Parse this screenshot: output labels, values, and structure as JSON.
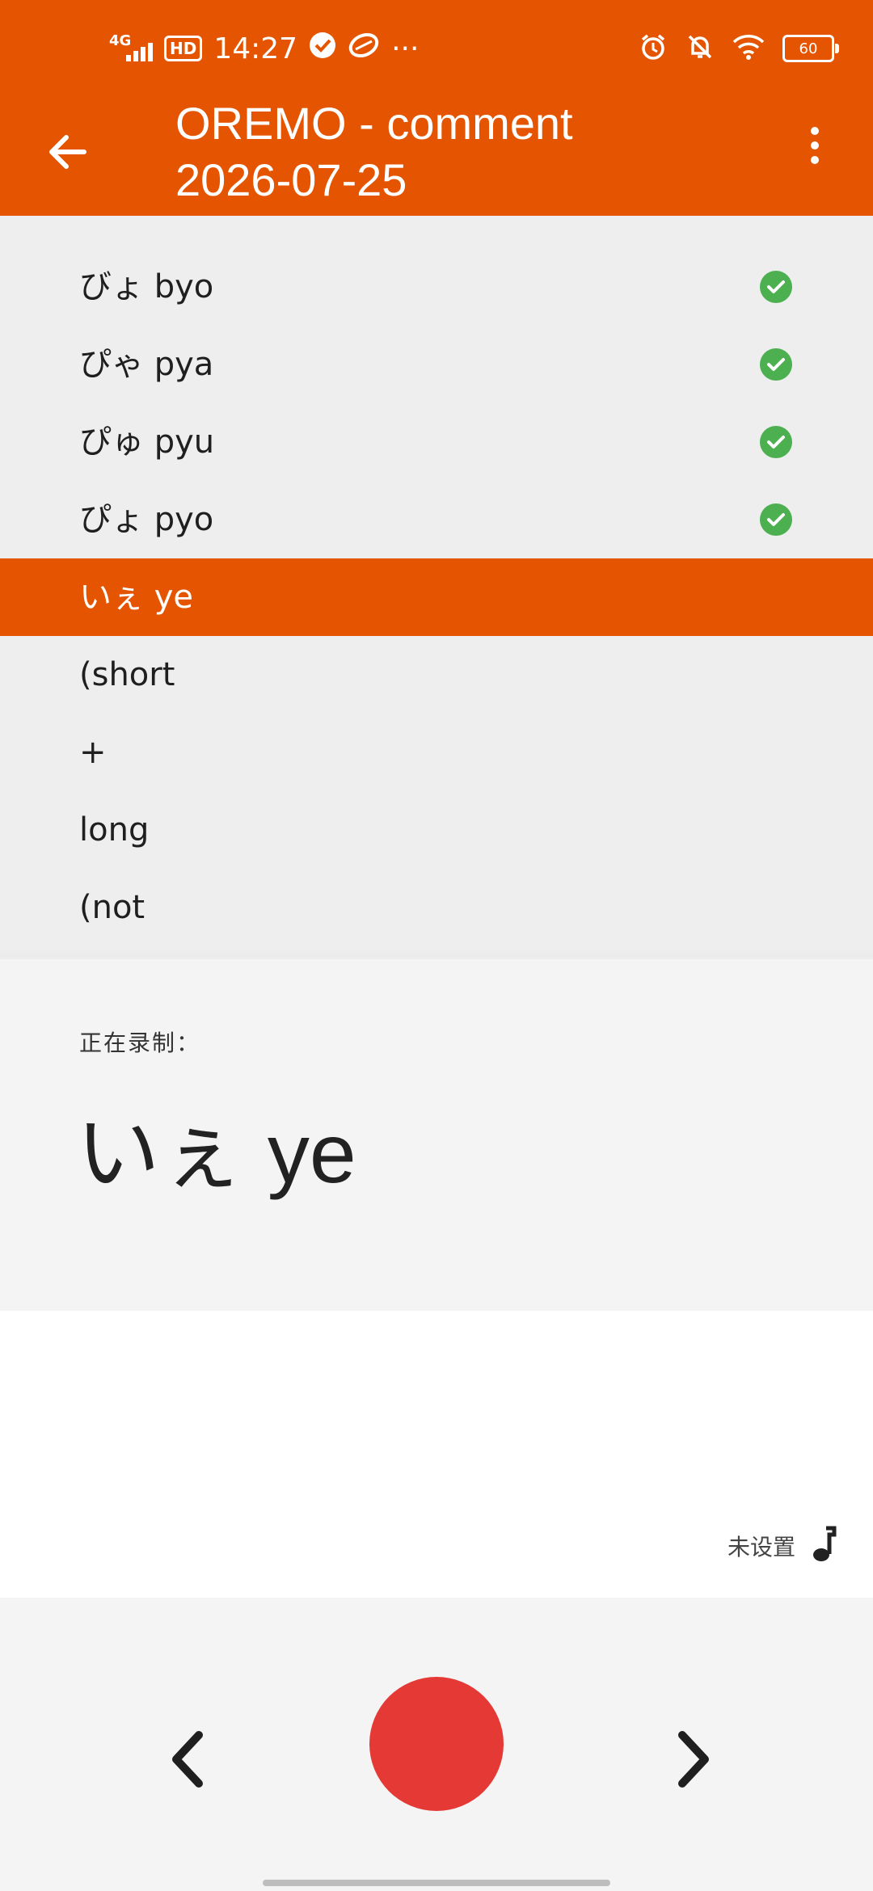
{
  "status_bar": {
    "network": "4G",
    "hd": "HD",
    "time": "14:27",
    "more": "···",
    "battery": "60"
  },
  "header": {
    "title": "OREMO - comment 2026-07-25",
    "accent": "#e55400"
  },
  "list": {
    "items": [
      {
        "label": "びょ byo",
        "done": true
      },
      {
        "label": "ぴゃ pya",
        "done": true
      },
      {
        "label": "ぴゅ pyu",
        "done": true
      },
      {
        "label": "ぴょ pyo",
        "done": true
      },
      {
        "label": "いぇ ye",
        "selected": true
      },
      {
        "label": "(short"
      },
      {
        "label": "+"
      },
      {
        "label": "long"
      },
      {
        "label": "(not"
      }
    ]
  },
  "recording": {
    "caption": "正在录制：",
    "current": "いぇ ye"
  },
  "tone": {
    "label": "未设置",
    "icon": "music-note-icon"
  },
  "controls": {
    "prev_icon": "chevron-left-icon",
    "record_icon": "record-icon",
    "next_icon": "chevron-right-icon",
    "record_color": "#e53935"
  }
}
